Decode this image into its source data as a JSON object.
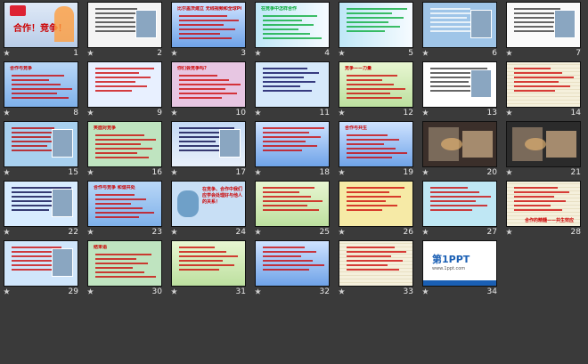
{
  "slides": [
    {
      "n": "1",
      "theme": "title",
      "title": "合作！竞争！"
    },
    {
      "n": "2",
      "theme": "news"
    },
    {
      "n": "3",
      "theme": "bluetxt",
      "title": "比尔盖茨建立 无线视频和全球PC业务"
    },
    {
      "n": "4",
      "theme": "cyanstripe",
      "title": "在竞争中怎样合作"
    },
    {
      "n": "5",
      "theme": "cyanstripe"
    },
    {
      "n": "6",
      "theme": "photos"
    },
    {
      "n": "7",
      "theme": "girl"
    },
    {
      "n": "8",
      "theme": "textbig",
      "title": "合作与竞争"
    },
    {
      "n": "9",
      "theme": "list"
    },
    {
      "n": "10",
      "theme": "pinkframe",
      "title": "你们会竞争吗?"
    },
    {
      "n": "11",
      "theme": "whiteboxes"
    },
    {
      "n": "12",
      "theme": "greenbox",
      "title": "竞争——力量"
    },
    {
      "n": "13",
      "theme": "person"
    },
    {
      "n": "14",
      "theme": "gridpaper"
    },
    {
      "n": "15",
      "theme": "sports"
    },
    {
      "n": "16",
      "theme": "greenpanel",
      "title": "笑面对竞争"
    },
    {
      "n": "17",
      "theme": "cartoon"
    },
    {
      "n": "18",
      "theme": "bluetxt"
    },
    {
      "n": "19",
      "theme": "bluetxt",
      "title": "合作与共生"
    },
    {
      "n": "20",
      "theme": "darkphoto"
    },
    {
      "n": "21",
      "theme": "darkphoto2"
    },
    {
      "n": "22",
      "theme": "sports2"
    },
    {
      "n": "23",
      "theme": "textbig",
      "title": "合作与竞争 和谐共处"
    },
    {
      "n": "24",
      "theme": "cat",
      "title": "在竞争、合作中我们应学会处理好与他人的关系！"
    },
    {
      "n": "25",
      "theme": "greenbox"
    },
    {
      "n": "26",
      "theme": "yellowbox"
    },
    {
      "n": "27",
      "theme": "cyanbox"
    },
    {
      "n": "28",
      "theme": "gridpaper",
      "caption": "合作的精髓——共生效应"
    },
    {
      "n": "29",
      "theme": "sports3"
    },
    {
      "n": "30",
      "theme": "greenpanel",
      "title": "结束语"
    },
    {
      "n": "31",
      "theme": "greenbox"
    },
    {
      "n": "32",
      "theme": "bluetxt"
    },
    {
      "n": "33",
      "theme": "gridpaper"
    },
    {
      "n": "34",
      "theme": "ppt",
      "title": "第1PPT",
      "subtitle": "www.1ppt.com"
    }
  ]
}
